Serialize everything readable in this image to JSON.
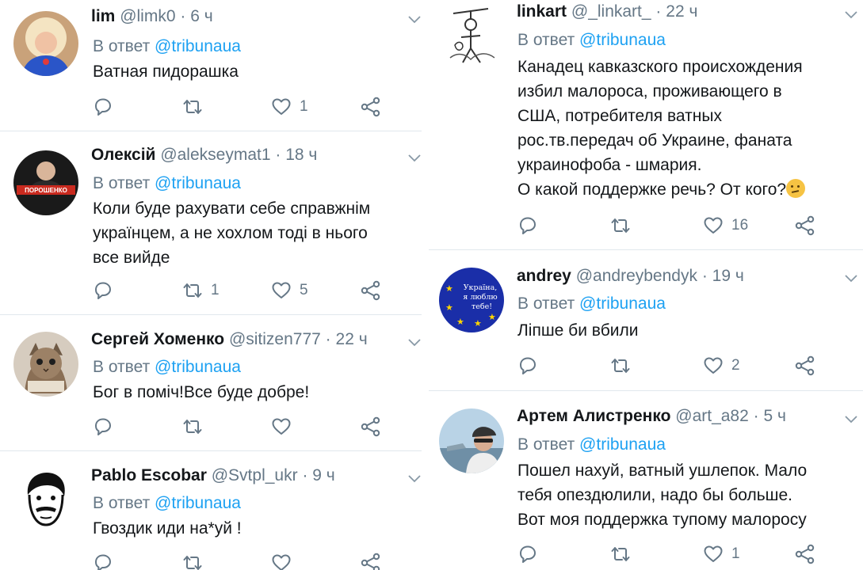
{
  "left_column": [
    {
      "name": "lim",
      "handle": "@limk0",
      "time": "6 ч",
      "reply_prefix": "В ответ",
      "reply_to": "@tribunaua",
      "text": "Ватная пидорашка",
      "replies": "",
      "retweets": "",
      "likes": "1",
      "avatar": "avatar-woman-icon"
    },
    {
      "name": "Олексій",
      "handle": "@alekseymat1",
      "time": "18 ч",
      "reply_prefix": "В ответ",
      "reply_to": "@tribunaua",
      "text": "Коли буде рахувати себе справжнім\nукраїнцем, а не хохлом тоді в нього\nвсе вийде",
      "replies": "",
      "retweets": "1",
      "likes": "5",
      "avatar": "avatar-poroshenko-icon",
      "avatar_label": "ПОРОШЕНКО"
    },
    {
      "name": "Сергей Хоменко",
      "handle": "@sitizen777",
      "time": "22 ч",
      "reply_prefix": "В ответ",
      "reply_to": "@tribunaua",
      "text": "Бог в поміч!Все буде добре!",
      "replies": "",
      "retweets": "",
      "likes": "",
      "avatar": "avatar-kitten-icon"
    },
    {
      "name": "Pablo Escobar",
      "handle": "@Svtpl_ukr",
      "time": "9 ч",
      "reply_prefix": "В ответ",
      "reply_to": "@tribunaua",
      "text": "Гвоздик иди на*уй !",
      "replies": "",
      "retweets": "",
      "likes": "",
      "avatar": "avatar-sketch-face-icon"
    }
  ],
  "right_column": [
    {
      "name": "linkart",
      "handle": "@_linkart_",
      "time": "22 ч",
      "reply_prefix": "В ответ",
      "reply_to": "@tribunaua",
      "text": "Канадец кавказского происхождения\nизбил малороса, проживающего в\nСША, потребителя ватных\nрос.тв.передач об Украине, фаната\nукраинофоба - шмария.\nО какой поддержке речь? От кого?",
      "emoji": "thinking-face-icon",
      "replies": "",
      "retweets": "",
      "likes": "16",
      "avatar": "avatar-sketch-figure-icon"
    },
    {
      "name": "andrey",
      "handle": "@andreybendyk",
      "time": "19 ч",
      "reply_prefix": "В ответ",
      "reply_to": "@tribunaua",
      "text": "Ліпше би вбили",
      "replies": "",
      "retweets": "",
      "likes": "2",
      "avatar": "avatar-eu-flag-icon",
      "avatar_label": "Україна, я люблю тебе!"
    },
    {
      "name": "Артем Алистренко",
      "handle": "@art_a82",
      "time": "5 ч",
      "reply_prefix": "В ответ",
      "reply_to": "@tribunaua",
      "text": "Пошел нахуй, ватный ушлепок. Мало\nтебя опездюлили, надо бы больше.\nВот моя поддержка тупому малоросу",
      "replies": "",
      "retweets": "",
      "likes": "1",
      "avatar": "avatar-man-cap-icon"
    }
  ],
  "colors": {
    "accent": "#1da1f2",
    "muted": "#657786",
    "text": "#14171a",
    "separator": "#e1e8ed"
  }
}
